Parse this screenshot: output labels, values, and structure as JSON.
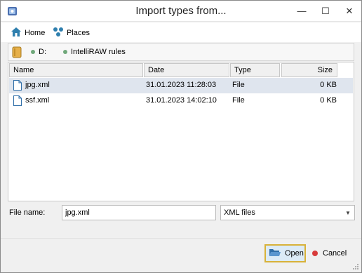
{
  "window": {
    "title": "Import types from...",
    "controls": {
      "minimize": "—",
      "maximize": "☐",
      "close": "✕"
    }
  },
  "toolbar": {
    "home_label": "Home",
    "places_label": "Places"
  },
  "path": {
    "crumbs": [
      "D:",
      "IntelliRAW rules"
    ]
  },
  "file_list": {
    "columns": {
      "name": "Name",
      "date": "Date",
      "type": "Type",
      "size": "Size"
    },
    "rows": [
      {
        "name": "jpg.xml",
        "date": "31.01.2023 11:28:03",
        "type": "File",
        "size": "0 KB",
        "selected": true
      },
      {
        "name": "ssf.xml",
        "date": "31.01.2023 14:02:10",
        "type": "File",
        "size": "0 KB",
        "selected": false
      }
    ]
  },
  "footer": {
    "file_name_label": "File name:",
    "file_name_value": "jpg.xml",
    "file_type_value": "XML files",
    "open_label": "Open",
    "cancel_label": "Cancel"
  }
}
